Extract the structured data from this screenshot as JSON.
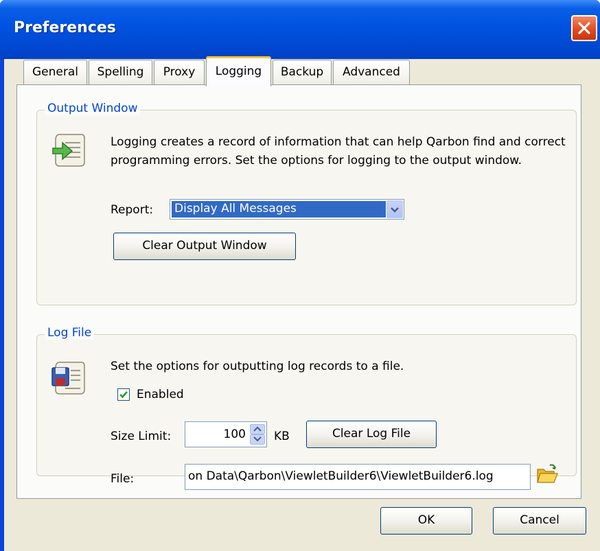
{
  "window": {
    "title": "Preferences"
  },
  "tabs": [
    {
      "label": "General"
    },
    {
      "label": "Spelling"
    },
    {
      "label": "Proxy"
    },
    {
      "label": "Logging"
    },
    {
      "label": "Backup"
    },
    {
      "label": "Advanced"
    }
  ],
  "active_tab": "Logging",
  "output_window": {
    "legend": "Output Window",
    "description": "Logging creates a record of information that can help Qarbon find and correct programming errors. Set the options for logging to the output window.",
    "report_label": "Report:",
    "report_value": "Display All Messages",
    "clear_button": "Clear Output Window"
  },
  "log_file": {
    "legend": "Log File",
    "description": "Set the options for outputting log records to a file.",
    "enabled_label": "Enabled",
    "enabled": true,
    "size_limit_label": "Size Limit:",
    "size_limit_value": "100",
    "size_unit": "KB",
    "clear_button": "Clear Log File",
    "file_label": "File:",
    "file_value": "on Data\\Qarbon\\ViewletBuilder6\\ViewletBuilder6.log"
  },
  "buttons": {
    "ok": "OK",
    "cancel": "Cancel"
  },
  "colors": {
    "titlebar": "#0052e0",
    "legend_text": "#0046d5",
    "selection": "#316ac5",
    "active_tab_accent": "#ffc83c"
  }
}
